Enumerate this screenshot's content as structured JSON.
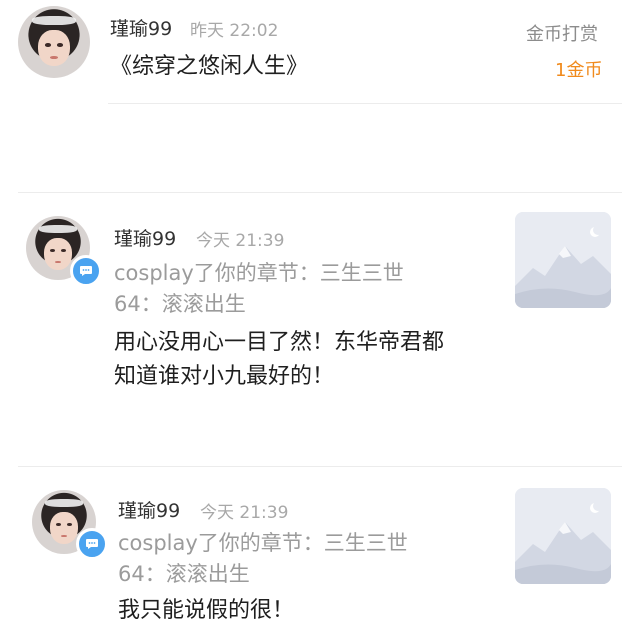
{
  "rewardPost": {
    "username": "瑾瑜99",
    "time": "昨天 22:02",
    "title": "《综穿之悠闲人生》",
    "reward_label": "金币打赏",
    "reward_amount": "1金币"
  },
  "comments": [
    {
      "username": "瑾瑜99",
      "time": "今天 21:39",
      "reference_line1": "cosplay了你的章节：三生三世",
      "reference_line2": "64：滚滚出生",
      "body_line1": "用心没用心一目了然！东华帝君都",
      "body_line2": "知道谁对小九最好的！",
      "badge_icon": "chat-bubble-icon",
      "thumbnail_icon": "mountain-placeholder-icon"
    },
    {
      "username": "瑾瑜99",
      "time": "今天 21:39",
      "reference_line1": "cosplay了你的章节：三生三世",
      "reference_line2": "64：滚滚出生",
      "body_line1": "我只能说假的很！",
      "body_line2": "",
      "badge_icon": "chat-bubble-icon",
      "thumbnail_icon": "mountain-placeholder-icon"
    }
  ],
  "colors": {
    "accent_orange": "#f08a1c",
    "badge_blue": "#4aa3f0",
    "muted_text": "#a8a8a8"
  }
}
